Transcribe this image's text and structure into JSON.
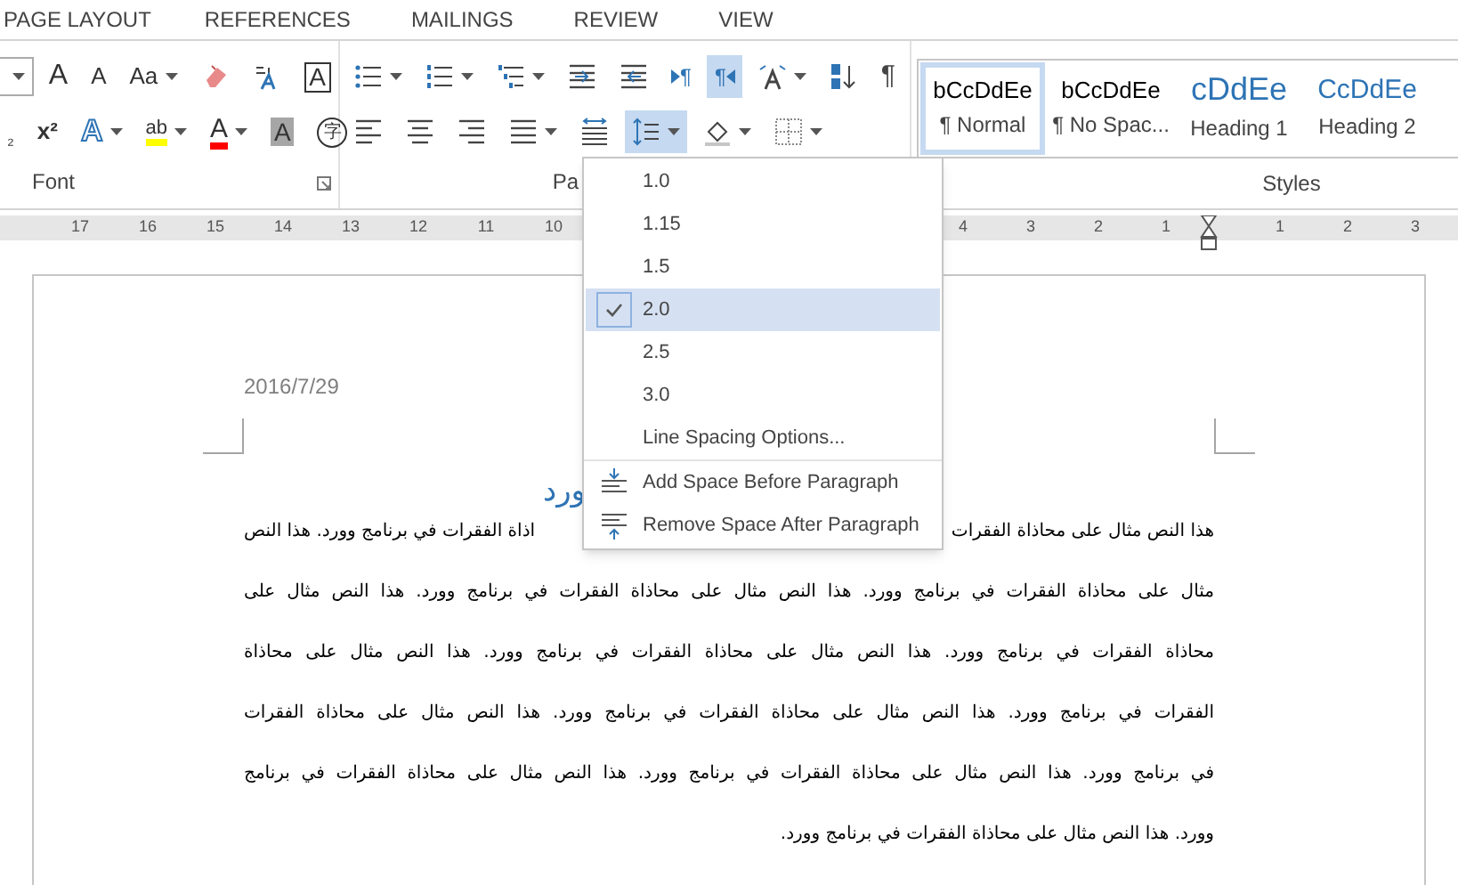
{
  "ribbon_tabs": [
    {
      "label": "PAGE LAYOUT"
    },
    {
      "label": "REFERENCES"
    },
    {
      "label": "MAILINGS"
    },
    {
      "label": "REVIEW"
    },
    {
      "label": "VIEW"
    }
  ],
  "font_group": {
    "label": "Font",
    "row1": [
      {
        "kind": "grow",
        "label": "A",
        "caret": false,
        "selected": false
      },
      {
        "kind": "shrink",
        "label": "A",
        "caret": false,
        "selected": false
      },
      {
        "kind": "case",
        "label": "Aa",
        "caret": true,
        "selected": false
      },
      {
        "kind": "eraser",
        "caret": false,
        "selected": false
      },
      {
        "kind": "phonetic",
        "caret": false,
        "selected": false
      },
      {
        "kind": "boxed",
        "label": "A",
        "caret": false,
        "selected": false
      }
    ],
    "row2": [
      {
        "kind": "subscript",
        "label": "₂",
        "caret": false,
        "selected": false
      },
      {
        "kind": "superscript",
        "label": "x²",
        "caret": false,
        "selected": false
      },
      {
        "kind": "effects",
        "label": "A",
        "caret": true,
        "selected": false
      },
      {
        "kind": "highlight",
        "label": "ab",
        "caret": true,
        "selected": false
      },
      {
        "kind": "font-color",
        "label": "A",
        "caret": true,
        "selected": false
      },
      {
        "kind": "shaded",
        "label": "A",
        "caret": false,
        "selected": false
      },
      {
        "kind": "enclose",
        "label": "字",
        "caret": false,
        "selected": false
      }
    ]
  },
  "paragraph_group": {
    "label": "Pa",
    "row1": [
      {
        "kind": "bullets",
        "caret": true,
        "selected": false
      },
      {
        "kind": "numbering",
        "caret": true,
        "selected": false
      },
      {
        "kind": "multilevel",
        "caret": true,
        "selected": false
      },
      {
        "kind": "indent-dec",
        "caret": false,
        "selected": false
      },
      {
        "kind": "indent-inc",
        "caret": false,
        "selected": false
      },
      {
        "kind": "ltr",
        "label": "¶",
        "caret": false,
        "selected": false
      },
      {
        "kind": "rtl",
        "label": "¶",
        "caret": false,
        "selected": true
      },
      {
        "kind": "asian",
        "caret": true,
        "selected": false
      },
      {
        "kind": "sort",
        "caret": false,
        "selected": false
      },
      {
        "kind": "pilcrow",
        "label": "¶",
        "caret": false,
        "selected": false
      }
    ],
    "row2": [
      {
        "kind": "align-left",
        "caret": false,
        "selected": false
      },
      {
        "kind": "align-center",
        "caret": false,
        "selected": false
      },
      {
        "kind": "align-right",
        "caret": false,
        "selected": false
      },
      {
        "kind": "justify",
        "caret": true,
        "selected": false
      },
      {
        "kind": "distributed",
        "caret": false,
        "selected": false
      },
      {
        "kind": "line-spacing",
        "caret": true,
        "selected": true
      },
      {
        "kind": "para-shading",
        "caret": true,
        "selected": false
      },
      {
        "kind": "borders",
        "caret": true,
        "selected": false
      }
    ]
  },
  "styles_group": {
    "label": "Styles",
    "items": [
      {
        "preview": "bCcDdEe",
        "name": "¶ Normal",
        "kind": "body",
        "selected": true
      },
      {
        "preview": "bCcDdEe",
        "name": "¶ No Spac...",
        "kind": "body",
        "selected": false
      },
      {
        "preview": "cDdEe",
        "name": "Heading 1",
        "kind": "heading1",
        "selected": false
      },
      {
        "preview": "CcDdEe",
        "name": "Heading 2",
        "kind": "heading2",
        "selected": false
      }
    ]
  },
  "ruler": {
    "left_numbers": [
      "17",
      "16",
      "15",
      "14",
      "13",
      "12",
      "11",
      "10"
    ],
    "right_numbers": [
      "4",
      "3",
      "2",
      "1"
    ],
    "after_numbers": [
      "1",
      "2",
      "3"
    ]
  },
  "line_spacing_menu": {
    "items": [
      {
        "kind": "value",
        "label": "1.0",
        "selected": false
      },
      {
        "kind": "value",
        "label": "1.15",
        "selected": false
      },
      {
        "kind": "value",
        "label": "1.5",
        "selected": false
      },
      {
        "kind": "value",
        "label": "2.0",
        "selected": true
      },
      {
        "kind": "value",
        "label": "2.5",
        "selected": false
      },
      {
        "kind": "value",
        "label": "3.0",
        "selected": false
      },
      {
        "kind": "option",
        "label": "Line Spacing Options..."
      },
      {
        "kind": "add-before",
        "label": "Add Space Before Paragraph"
      },
      {
        "kind": "remove-after",
        "label": "Remove Space After Paragraph"
      }
    ]
  },
  "document": {
    "date": "2016/7/29",
    "title_visible": "ورد",
    "first_line": {
      "right_part": "هذا النص مثال على محاذاة الفقرات",
      "left_part": "اذاة الفقرات في برنامج وورد. هذا النص"
    },
    "lines": [
      "مثال على محاذاة الفقرات في برنامج وورد. هذا النص مثال على محاذاة الفقرات في برنامج وورد. هذا النص مثال على",
      "محاذاة الفقرات في برنامج وورد. هذا النص مثال على محاذاة الفقرات في برنامج وورد. هذا النص مثال على محاذاة",
      "الفقرات في برنامج وورد. هذا النص مثال على محاذاة الفقرات في برنامج وورد. هذا النص مثال على محاذاة الفقرات",
      "في برنامج وورد. هذا النص مثال على محاذاة الفقرات في برنامج وورد. هذا النص مثال على محاذاة الفقرات في برنامج"
    ],
    "last_line": "وورد. هذا النص مثال على محاذاة الفقرات في برنامج وورد."
  }
}
